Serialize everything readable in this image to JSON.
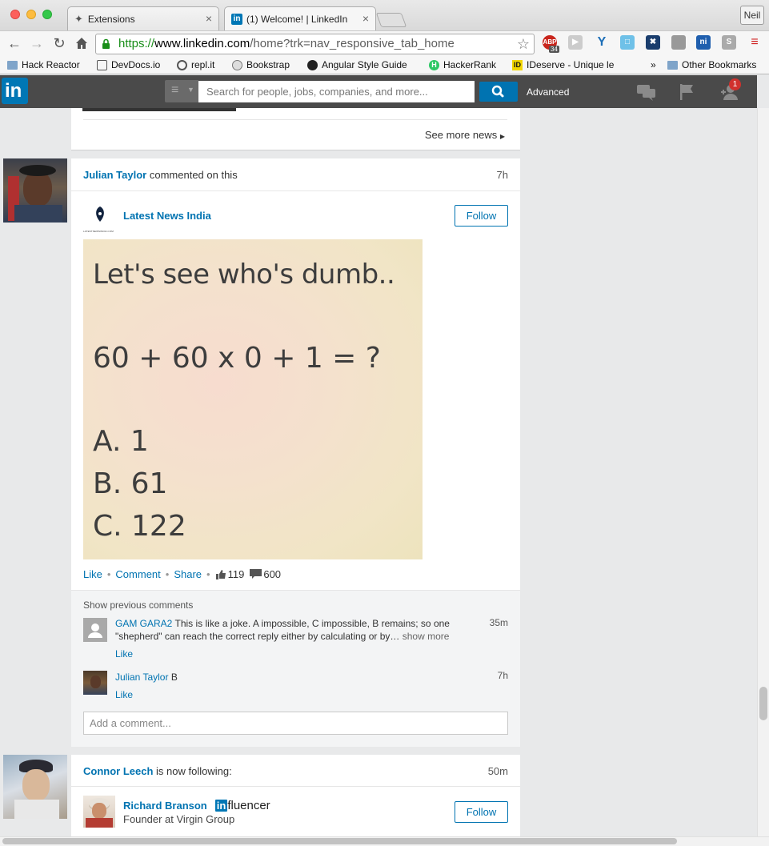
{
  "browser": {
    "tabs": [
      {
        "title": "Extensions",
        "icon": "puzzle-icon"
      },
      {
        "title": "(1) Welcome! | LinkedIn",
        "icon": "linkedin-icon"
      }
    ],
    "profile_name": "Neil",
    "url": {
      "scheme": "https://",
      "domain": "www.linkedin.com",
      "path": "/home?trk=nav_responsive_tab_home"
    },
    "extensions": {
      "abp_badge": "34"
    },
    "bookmarks": [
      {
        "label": "Hack Reactor",
        "icon": "folder-icon"
      },
      {
        "label": "DevDocs.io",
        "icon": "devdocs-icon"
      },
      {
        "label": "repl.it",
        "icon": "replit-icon"
      },
      {
        "label": "Bookstrap",
        "icon": "bookstrap-icon"
      },
      {
        "label": "Angular Style Guide",
        "icon": "github-icon"
      },
      {
        "label": "HackerRank",
        "icon": "hackerrank-icon"
      },
      {
        "label": "IDeserve - Unique le",
        "icon": "ideserve-icon"
      }
    ],
    "bookmarks_overflow": "»",
    "other_bookmarks": "Other Bookmarks"
  },
  "linkedin": {
    "logo": "in",
    "search_placeholder": "Search for people, jobs, companies, and more...",
    "advanced": "Advanced",
    "connections_badge": "1"
  },
  "news_card": {
    "see_more": "See more news"
  },
  "post1": {
    "actor": "Julian Taylor",
    "action": "commented on this",
    "time": "7h",
    "company": "Latest News India",
    "company_logo_caption": "LATESTNEWSINDIA.COM",
    "follow": "Follow",
    "image_lines": [
      "Let's see who's dumb..",
      "60 + 60 x 0 + 1 = ?",
      "A. 1",
      "B. 61",
      "C. 122"
    ],
    "like": "Like",
    "comment": "Comment",
    "share": "Share",
    "likes_count": "119",
    "comments_count": "600",
    "show_previous": "Show previous comments",
    "comments": [
      {
        "author": "GAM GARA2",
        "text": "This is like a joke. A impossible, C impossible, B remains; so one \"shepherd\" can reach the correct reply either by calculating or by…",
        "more": "show more",
        "time": "35m",
        "like": "Like"
      },
      {
        "author": "Julian Taylor",
        "text": "B",
        "time": "7h",
        "like": "Like"
      }
    ],
    "add_comment_placeholder": "Add a comment..."
  },
  "post2": {
    "actor": "Connor Leech",
    "action": "is now following:",
    "time": "50m",
    "person": "Richard Branson",
    "influencer_in": "in",
    "influencer_text": "fluencer",
    "headline": "Founder at Virgin Group",
    "follow": "Follow"
  },
  "colors": {
    "linkedin_blue": "#0073b1",
    "header_dark": "#4a4a4a",
    "page_bg": "#e8e9ea"
  }
}
